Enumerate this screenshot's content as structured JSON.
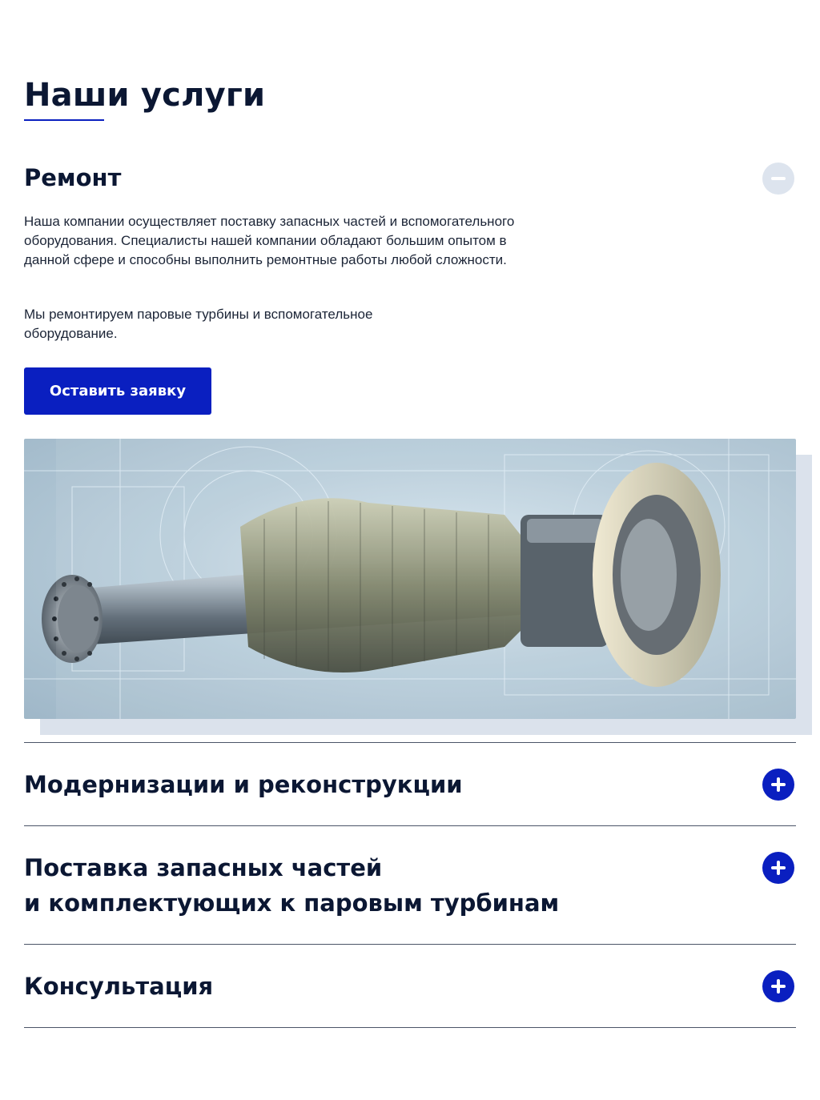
{
  "section": {
    "title": "Наши услуги"
  },
  "open_item": {
    "title": "Ремонт",
    "toggle_icon": "minus-icon",
    "paragraph_1": "Наша компании осуществляет поставку запасных частей и вспомогательного оборудования. Специалисты нашей компании обладают большим опытом в данной сфере и способны выполнить ремонтные работы любой сложности.",
    "paragraph_2": "Мы ремонтируем паровые турбины и вспомогательное оборудование.",
    "cta_label": "Оставить заявку",
    "image": "turbine-rotor-image"
  },
  "items": [
    {
      "title": "Модернизации и реконструкции",
      "toggle_icon": "plus-icon"
    },
    {
      "title_line_1": "Поставка запасных частей",
      "title_line_2": "и комплектующих к паровым турбинам",
      "toggle_icon": "plus-icon"
    },
    {
      "title": "Консультация",
      "toggle_icon": "plus-icon"
    }
  ],
  "colors": {
    "accent": "#0a1fc0",
    "heading": "#0b1733",
    "minus_toggle_bg": "#dde4ee",
    "divider": "#4b5467"
  }
}
